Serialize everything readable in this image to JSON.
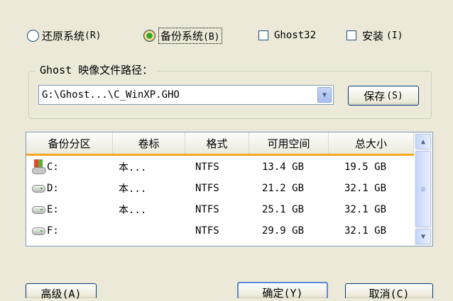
{
  "options": {
    "restore": "还原系统",
    "restore_hotkey": "(R)",
    "backup": "备份系统",
    "backup_hotkey": "(B)",
    "backup_selected": true,
    "ghost32": "Ghost32",
    "install": "安装",
    "install_hotkey": "(I)"
  },
  "image_path": {
    "group_title": "Ghost 映像文件路径：",
    "value": "G:\\Ghost...\\C_WinXP.GHO",
    "save_label": "保存",
    "save_hotkey": "(S)"
  },
  "partition_table": {
    "columns": [
      "备份分区",
      "卷标",
      "格式",
      "可用空间",
      "总大小"
    ],
    "rows": [
      {
        "drive": "C:",
        "label": "本...",
        "format": "NTFS",
        "free": "13.4 GB",
        "total": "19.5 GB",
        "icon": "system-drive-icon"
      },
      {
        "drive": "D:",
        "label": "本...",
        "format": "NTFS",
        "free": "21.2 GB",
        "total": "32.1 GB",
        "icon": "hard-drive-icon"
      },
      {
        "drive": "E:",
        "label": "本...",
        "format": "NTFS",
        "free": "25.1 GB",
        "total": "32.1 GB",
        "icon": "hard-drive-icon"
      },
      {
        "drive": "F:",
        "label": "",
        "format": "NTFS",
        "free": "29.9 GB",
        "total": "32.1 GB",
        "icon": "hard-drive-icon"
      }
    ]
  },
  "buttons": {
    "advanced": "高级(A)",
    "ok": "确定(Y)",
    "cancel": "取消(C)"
  },
  "colors": {
    "header_accent": "#f7a624",
    "radio_selected": "#2fa72f",
    "window_bg": "#ece9d8"
  }
}
